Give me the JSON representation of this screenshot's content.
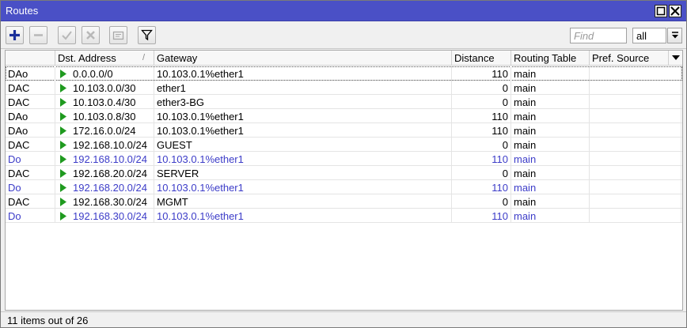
{
  "window": {
    "title": "Routes"
  },
  "toolbar": {
    "buttons": [
      {
        "name": "add-button",
        "icon": "plus-icon"
      },
      {
        "name": "remove-button",
        "icon": "minus-icon"
      },
      {
        "name": "enable-button",
        "icon": "check-icon"
      },
      {
        "name": "disable-button",
        "icon": "x-icon"
      },
      {
        "name": "comment-button",
        "icon": "note-icon"
      },
      {
        "name": "filter-button",
        "icon": "filter-icon"
      }
    ],
    "find_placeholder": "Find",
    "filter_value": "all"
  },
  "table": {
    "columns": {
      "flags": "",
      "dst": "Dst. Address",
      "sort_mark": "/",
      "gateway": "Gateway",
      "distance": "Distance",
      "routing_table": "Routing Table",
      "pref_source": "Pref. Source"
    },
    "rows": [
      {
        "flags": "DAo",
        "dst": "0.0.0.0/0",
        "gateway": "10.103.0.1%ether1",
        "distance": "110",
        "routing_table": "main",
        "pref_source": "",
        "inactive": false
      },
      {
        "flags": "DAC",
        "dst": "10.103.0.0/30",
        "gateway": "ether1",
        "distance": "0",
        "routing_table": "main",
        "pref_source": "",
        "inactive": false
      },
      {
        "flags": "DAC",
        "dst": "10.103.0.4/30",
        "gateway": "ether3-BG",
        "distance": "0",
        "routing_table": "main",
        "pref_source": "",
        "inactive": false
      },
      {
        "flags": "DAo",
        "dst": "10.103.0.8/30",
        "gateway": "10.103.0.1%ether1",
        "distance": "110",
        "routing_table": "main",
        "pref_source": "",
        "inactive": false
      },
      {
        "flags": "DAo",
        "dst": "172.16.0.0/24",
        "gateway": "10.103.0.1%ether1",
        "distance": "110",
        "routing_table": "main",
        "pref_source": "",
        "inactive": false
      },
      {
        "flags": "DAC",
        "dst": "192.168.10.0/24",
        "gateway": "GUEST",
        "distance": "0",
        "routing_table": "main",
        "pref_source": "",
        "inactive": false
      },
      {
        "flags": "Do",
        "dst": "192.168.10.0/24",
        "gateway": "10.103.0.1%ether1",
        "distance": "110",
        "routing_table": "main",
        "pref_source": "",
        "inactive": true
      },
      {
        "flags": "DAC",
        "dst": "192.168.20.0/24",
        "gateway": "SERVER",
        "distance": "0",
        "routing_table": "main",
        "pref_source": "",
        "inactive": false
      },
      {
        "flags": "Do",
        "dst": "192.168.20.0/24",
        "gateway": "10.103.0.1%ether1",
        "distance": "110",
        "routing_table": "main",
        "pref_source": "",
        "inactive": true
      },
      {
        "flags": "DAC",
        "dst": "192.168.30.0/24",
        "gateway": "MGMT",
        "distance": "0",
        "routing_table": "main",
        "pref_source": "",
        "inactive": false
      },
      {
        "flags": "Do",
        "dst": "192.168.30.0/24",
        "gateway": "10.103.0.1%ether1",
        "distance": "110",
        "routing_table": "main",
        "pref_source": "",
        "inactive": true
      }
    ]
  },
  "status": {
    "text": "11 items out of 26"
  },
  "colors": {
    "titlebar": "#4a50c6",
    "inactive_text": "#3c3cc8",
    "route_arrow": "#1f9a1f",
    "add_icon": "#1a2f9a"
  }
}
